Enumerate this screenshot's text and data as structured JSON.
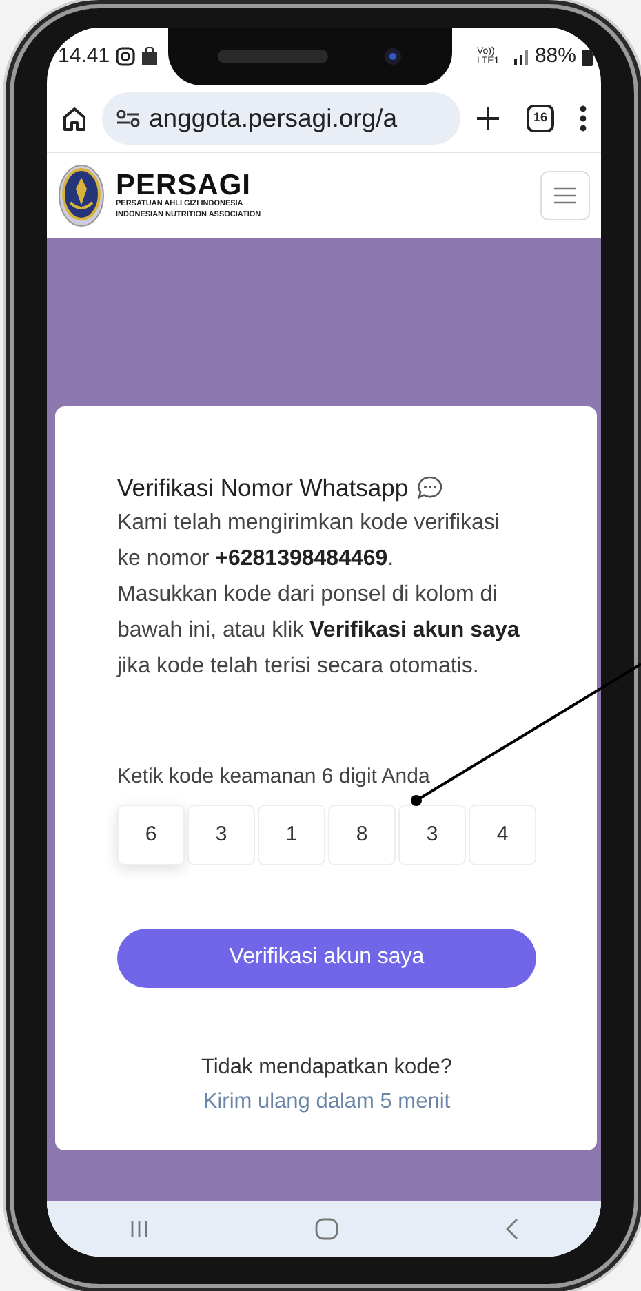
{
  "status_bar": {
    "time": "14.41",
    "network": "Vo)) LTE1",
    "battery": "88%"
  },
  "browser": {
    "url": "anggota.persagi.org/a",
    "tab_count": "16"
  },
  "site_header": {
    "brand": "PERSAGI",
    "subtitle_lines": [
      "PERSATUAN AHLI GIZI INDONESIA",
      "INDONESIAN NUTRITION ASSOCIATION"
    ]
  },
  "verification_card": {
    "title": "Verifikasi Nomor Whatsapp",
    "paragraphs": [
      "Kami telah mengirimkan kode verifikasi ke nomor **+6281398484469**.",
      "Masukkan kode dari ponsel di kolom di bawah ini, atau klik **Verifikasi akun saya** jika kode telah terisi secara otomatis."
    ],
    "code_label": "Ketik kode keamanan 6 digit Anda",
    "code_digits": [
      {
        "value": "6",
        "selected": true
      },
      {
        "value": "3",
        "selected": false
      },
      {
        "value": "1",
        "selected": false
      },
      {
        "value": "8",
        "selected": false
      },
      {
        "value": "3",
        "selected": false
      },
      {
        "value": "4",
        "selected": false
      }
    ],
    "submit_button": "Verifikasi akun saya",
    "resend_question": "Tidak mendapatkan kode?",
    "resend_link": "Kirim ulang dalam 5 menit"
  }
}
